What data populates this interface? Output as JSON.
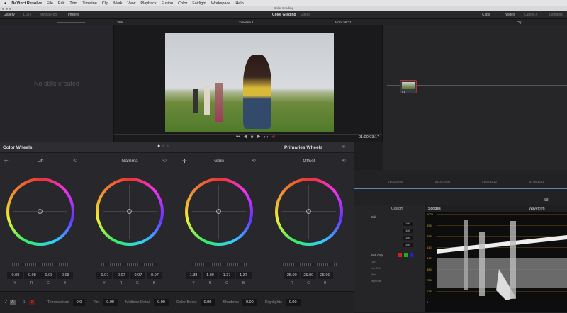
{
  "menubar": {
    "items": [
      "DaVinci Resolve",
      "File",
      "Edit",
      "Trim",
      "Timeline",
      "Clip",
      "Mark",
      "View",
      "Playback",
      "Fusion",
      "Color",
      "Fairlight",
      "Workspace",
      "Help"
    ]
  },
  "window": {
    "title": "Color Grading"
  },
  "topbar": {
    "left": [
      "Gallery",
      "LUTs",
      "Media Pool",
      "Timeline"
    ],
    "title": "Color Grading",
    "status": "Edited",
    "right": [
      "Clips",
      "Nodes",
      "OpenFX",
      "Lightbox"
    ]
  },
  "toolbar": {
    "zoom": "38%",
    "timeline": "Timeline 1",
    "timecode": "16:24:56:21",
    "clip_mode": "Clip"
  },
  "stills": {
    "empty": "No stills created"
  },
  "viewer": {
    "timecode": "01:00:03:17"
  },
  "node": {
    "label": "01"
  },
  "color_wheels": {
    "title": "Color Wheels",
    "mode": "Primaries Wheels",
    "wheels": [
      {
        "name": "Lift",
        "values": [
          "-0.08",
          "-0.08",
          "-0.08",
          "-0.08"
        ],
        "channels": [
          "Y",
          "R",
          "G",
          "B"
        ],
        "colors": [
          "#c44",
          "#c4c",
          "#44c",
          "#4cc",
          "#4c4",
          "#cc4"
        ]
      },
      {
        "name": "Gamma",
        "values": [
          "-0.07",
          "-0.07",
          "-0.07",
          "-0.07"
        ],
        "channels": [
          "Y",
          "R",
          "G",
          "B"
        ]
      },
      {
        "name": "Gain",
        "values": [
          "1.38",
          "1.39",
          "1.37",
          "1.37"
        ],
        "channels": [
          "Y",
          "R",
          "G",
          "B"
        ]
      },
      {
        "name": "Offset",
        "values": [
          "25.00",
          "25.00",
          "25.00"
        ],
        "channels": [
          "R",
          "G",
          "B"
        ]
      }
    ]
  },
  "bottom": {
    "page1": "1",
    "page2": "2",
    "params": [
      {
        "label": "Temperature",
        "value": "0.0"
      },
      {
        "label": "Tint",
        "value": "0.00"
      },
      {
        "label": "Midtone Detail",
        "value": "0.00"
      },
      {
        "label": "Color Boost",
        "value": "0.00"
      },
      {
        "label": "Shadows",
        "value": "0.00"
      },
      {
        "label": "Highlights",
        "value": "0.00"
      }
    ]
  },
  "timeline": {
    "ticks": [
      "01:00:26:00",
      "01:00:29:06",
      "01:00:32:12",
      "01:00:35:18"
    ]
  },
  "curves": {
    "mode": "Custom",
    "edit": "Edit",
    "channels": [
      "100",
      "100",
      "100",
      "100"
    ],
    "soft_clip": "Soft Clip",
    "rows": [
      "Low",
      "Low Soft",
      "High",
      "High Soft"
    ]
  },
  "scopes": {
    "title": "Scopes",
    "mode": "Waveform",
    "ticks": [
      "1023",
      "896",
      "768",
      "640",
      "512",
      "384",
      "256",
      "128",
      "0"
    ]
  }
}
